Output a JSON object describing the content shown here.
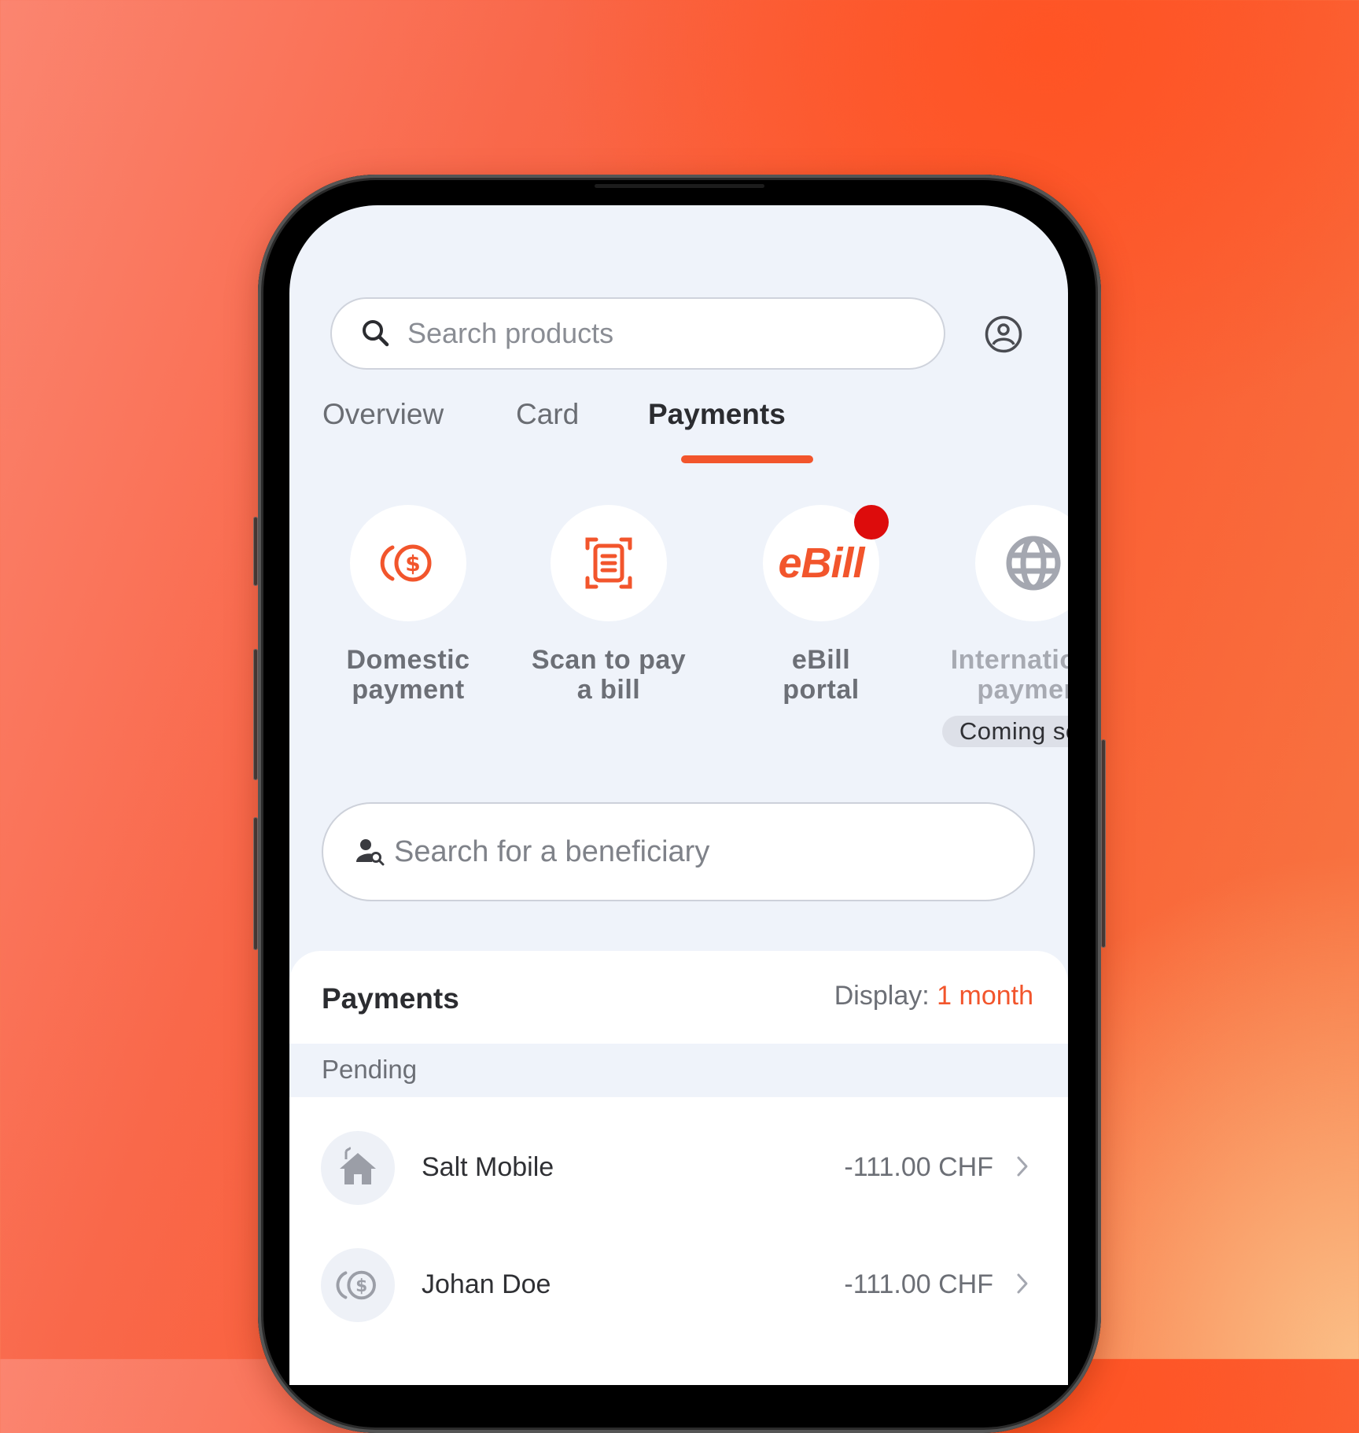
{
  "search": {
    "placeholder": "Search products"
  },
  "tabs": [
    {
      "label": "Overview",
      "active": false
    },
    {
      "label": "Card",
      "active": false
    },
    {
      "label": "Payments",
      "active": true
    }
  ],
  "quick_actions": [
    {
      "line1": "Domestic",
      "line2": "payment",
      "icon": "coin-dollar-icon"
    },
    {
      "line1": "Scan to pay",
      "line2": "a bill",
      "icon": "scan-document-icon"
    },
    {
      "line1": "eBill",
      "line2": "portal",
      "icon": "ebill-logo",
      "logo_text": "eBill",
      "has_notification": true
    },
    {
      "line1": "International",
      "line2": "payment",
      "icon": "globe-icon",
      "disabled": true,
      "badge": "Coming soon"
    }
  ],
  "beneficiary_search": {
    "placeholder": "Search for a beneficiary"
  },
  "payments": {
    "title": "Payments",
    "display_label": "Display:",
    "display_value": "1 month",
    "section": "Pending",
    "items": [
      {
        "name": "Salt Mobile",
        "amount": "-111.00 CHF",
        "icon": "house-icon"
      },
      {
        "name": "Johan Doe",
        "amount": "-111.00 CHF",
        "icon": "coin-dollar-icon"
      }
    ]
  },
  "colors": {
    "accent": "#f2552c",
    "notification": "#dd0c0c",
    "screen_bg": "#eff3fa"
  }
}
